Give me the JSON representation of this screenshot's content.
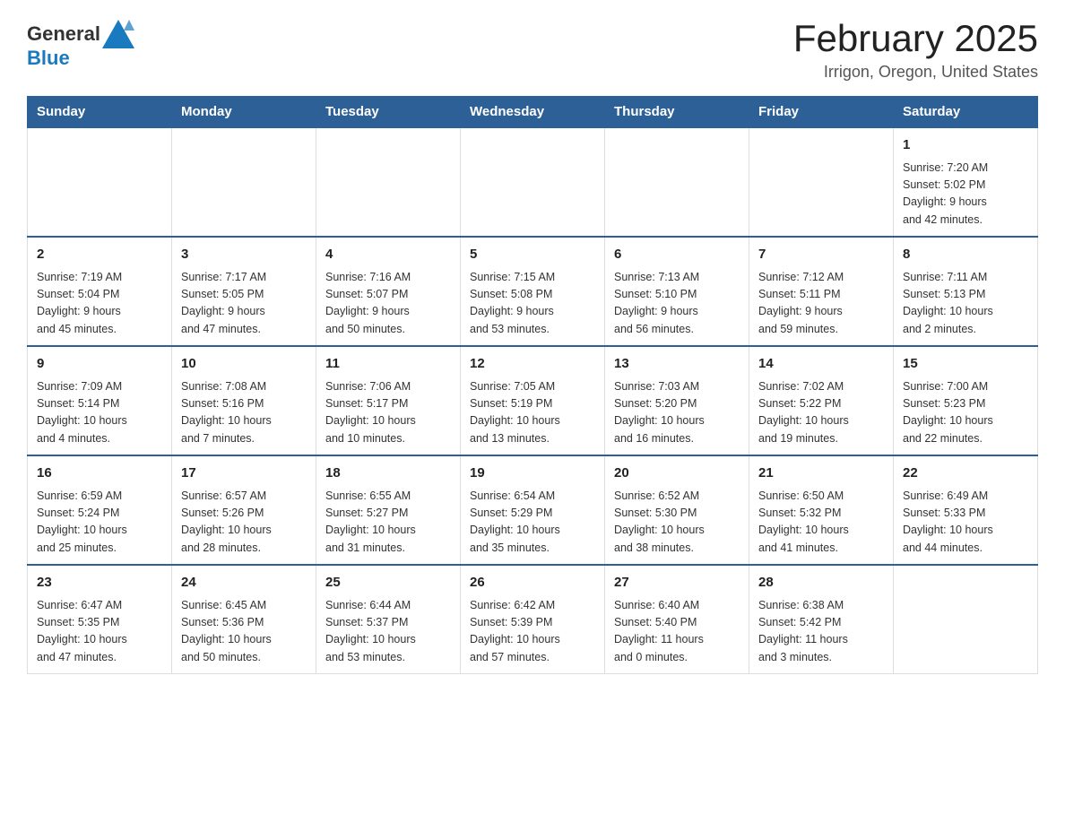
{
  "header": {
    "logo_general": "General",
    "logo_blue": "Blue",
    "title": "February 2025",
    "subtitle": "Irrigon, Oregon, United States"
  },
  "weekdays": [
    "Sunday",
    "Monday",
    "Tuesday",
    "Wednesday",
    "Thursday",
    "Friday",
    "Saturday"
  ],
  "weeks": [
    [
      {
        "day": "",
        "info": ""
      },
      {
        "day": "",
        "info": ""
      },
      {
        "day": "",
        "info": ""
      },
      {
        "day": "",
        "info": ""
      },
      {
        "day": "",
        "info": ""
      },
      {
        "day": "",
        "info": ""
      },
      {
        "day": "1",
        "info": "Sunrise: 7:20 AM\nSunset: 5:02 PM\nDaylight: 9 hours\nand 42 minutes."
      }
    ],
    [
      {
        "day": "2",
        "info": "Sunrise: 7:19 AM\nSunset: 5:04 PM\nDaylight: 9 hours\nand 45 minutes."
      },
      {
        "day": "3",
        "info": "Sunrise: 7:17 AM\nSunset: 5:05 PM\nDaylight: 9 hours\nand 47 minutes."
      },
      {
        "day": "4",
        "info": "Sunrise: 7:16 AM\nSunset: 5:07 PM\nDaylight: 9 hours\nand 50 minutes."
      },
      {
        "day": "5",
        "info": "Sunrise: 7:15 AM\nSunset: 5:08 PM\nDaylight: 9 hours\nand 53 minutes."
      },
      {
        "day": "6",
        "info": "Sunrise: 7:13 AM\nSunset: 5:10 PM\nDaylight: 9 hours\nand 56 minutes."
      },
      {
        "day": "7",
        "info": "Sunrise: 7:12 AM\nSunset: 5:11 PM\nDaylight: 9 hours\nand 59 minutes."
      },
      {
        "day": "8",
        "info": "Sunrise: 7:11 AM\nSunset: 5:13 PM\nDaylight: 10 hours\nand 2 minutes."
      }
    ],
    [
      {
        "day": "9",
        "info": "Sunrise: 7:09 AM\nSunset: 5:14 PM\nDaylight: 10 hours\nand 4 minutes."
      },
      {
        "day": "10",
        "info": "Sunrise: 7:08 AM\nSunset: 5:16 PM\nDaylight: 10 hours\nand 7 minutes."
      },
      {
        "day": "11",
        "info": "Sunrise: 7:06 AM\nSunset: 5:17 PM\nDaylight: 10 hours\nand 10 minutes."
      },
      {
        "day": "12",
        "info": "Sunrise: 7:05 AM\nSunset: 5:19 PM\nDaylight: 10 hours\nand 13 minutes."
      },
      {
        "day": "13",
        "info": "Sunrise: 7:03 AM\nSunset: 5:20 PM\nDaylight: 10 hours\nand 16 minutes."
      },
      {
        "day": "14",
        "info": "Sunrise: 7:02 AM\nSunset: 5:22 PM\nDaylight: 10 hours\nand 19 minutes."
      },
      {
        "day": "15",
        "info": "Sunrise: 7:00 AM\nSunset: 5:23 PM\nDaylight: 10 hours\nand 22 minutes."
      }
    ],
    [
      {
        "day": "16",
        "info": "Sunrise: 6:59 AM\nSunset: 5:24 PM\nDaylight: 10 hours\nand 25 minutes."
      },
      {
        "day": "17",
        "info": "Sunrise: 6:57 AM\nSunset: 5:26 PM\nDaylight: 10 hours\nand 28 minutes."
      },
      {
        "day": "18",
        "info": "Sunrise: 6:55 AM\nSunset: 5:27 PM\nDaylight: 10 hours\nand 31 minutes."
      },
      {
        "day": "19",
        "info": "Sunrise: 6:54 AM\nSunset: 5:29 PM\nDaylight: 10 hours\nand 35 minutes."
      },
      {
        "day": "20",
        "info": "Sunrise: 6:52 AM\nSunset: 5:30 PM\nDaylight: 10 hours\nand 38 minutes."
      },
      {
        "day": "21",
        "info": "Sunrise: 6:50 AM\nSunset: 5:32 PM\nDaylight: 10 hours\nand 41 minutes."
      },
      {
        "day": "22",
        "info": "Sunrise: 6:49 AM\nSunset: 5:33 PM\nDaylight: 10 hours\nand 44 minutes."
      }
    ],
    [
      {
        "day": "23",
        "info": "Sunrise: 6:47 AM\nSunset: 5:35 PM\nDaylight: 10 hours\nand 47 minutes."
      },
      {
        "day": "24",
        "info": "Sunrise: 6:45 AM\nSunset: 5:36 PM\nDaylight: 10 hours\nand 50 minutes."
      },
      {
        "day": "25",
        "info": "Sunrise: 6:44 AM\nSunset: 5:37 PM\nDaylight: 10 hours\nand 53 minutes."
      },
      {
        "day": "26",
        "info": "Sunrise: 6:42 AM\nSunset: 5:39 PM\nDaylight: 10 hours\nand 57 minutes."
      },
      {
        "day": "27",
        "info": "Sunrise: 6:40 AM\nSunset: 5:40 PM\nDaylight: 11 hours\nand 0 minutes."
      },
      {
        "day": "28",
        "info": "Sunrise: 6:38 AM\nSunset: 5:42 PM\nDaylight: 11 hours\nand 3 minutes."
      },
      {
        "day": "",
        "info": ""
      }
    ]
  ]
}
